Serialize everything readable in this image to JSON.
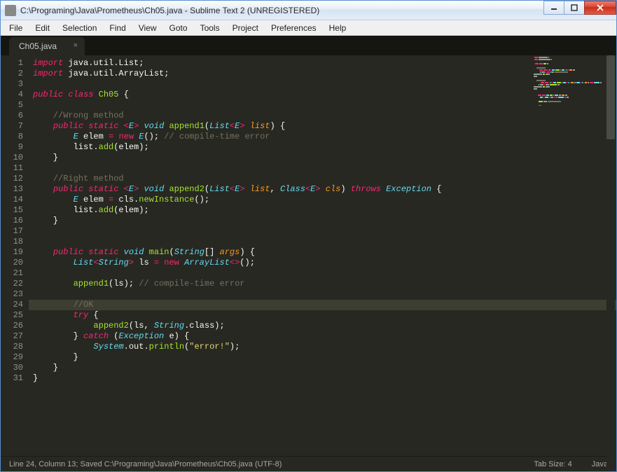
{
  "window": {
    "title": "C:\\Programing\\Java\\Prometheus\\Ch05.java - Sublime Text 2 (UNREGISTERED)"
  },
  "menu": {
    "items": [
      "File",
      "Edit",
      "Selection",
      "Find",
      "View",
      "Goto",
      "Tools",
      "Project",
      "Preferences",
      "Help"
    ]
  },
  "tab": {
    "label": "Ch05.java"
  },
  "code": {
    "line_count": 31,
    "highlighted_line": 24,
    "lines": [
      [
        [
          "kw",
          "import"
        ],
        [
          "p",
          " "
        ],
        [
          "pkg",
          "java.util.List"
        ],
        [
          "p",
          ";"
        ]
      ],
      [
        [
          "kw",
          "import"
        ],
        [
          "p",
          " "
        ],
        [
          "pkg",
          "java.util.ArrayList"
        ],
        [
          "p",
          ";"
        ]
      ],
      [],
      [
        [
          "kw",
          "public"
        ],
        [
          "p",
          " "
        ],
        [
          "kw",
          "class"
        ],
        [
          "p",
          " "
        ],
        [
          "func",
          "Ch05"
        ],
        [
          "p",
          " {"
        ]
      ],
      [],
      [
        [
          "p",
          "    "
        ],
        [
          "cmt",
          "//Wrong method"
        ]
      ],
      [
        [
          "p",
          "    "
        ],
        [
          "kw",
          "public"
        ],
        [
          "p",
          " "
        ],
        [
          "kw",
          "static"
        ],
        [
          "p",
          " "
        ],
        [
          "op",
          "<"
        ],
        [
          "type",
          "E"
        ],
        [
          "op",
          ">"
        ],
        [
          "p",
          " "
        ],
        [
          "type",
          "void"
        ],
        [
          "p",
          " "
        ],
        [
          "func",
          "append1"
        ],
        [
          "p",
          "("
        ],
        [
          "type",
          "List"
        ],
        [
          "op",
          "<"
        ],
        [
          "type",
          "E"
        ],
        [
          "op",
          ">"
        ],
        [
          "p",
          " "
        ],
        [
          "var",
          "list"
        ],
        [
          "p",
          ") {"
        ]
      ],
      [
        [
          "p",
          "        "
        ],
        [
          "type",
          "E"
        ],
        [
          "p",
          " elem "
        ],
        [
          "op",
          "="
        ],
        [
          "p",
          " "
        ],
        [
          "kw2",
          "new"
        ],
        [
          "p",
          " "
        ],
        [
          "type",
          "E"
        ],
        [
          "p",
          "(); "
        ],
        [
          "cmt",
          "// compile-time error"
        ]
      ],
      [
        [
          "p",
          "        list."
        ],
        [
          "func",
          "add"
        ],
        [
          "p",
          "(elem);"
        ]
      ],
      [
        [
          "p",
          "    }"
        ]
      ],
      [],
      [
        [
          "p",
          "    "
        ],
        [
          "cmt",
          "//Right method"
        ]
      ],
      [
        [
          "p",
          "    "
        ],
        [
          "kw",
          "public"
        ],
        [
          "p",
          " "
        ],
        [
          "kw",
          "static"
        ],
        [
          "p",
          " "
        ],
        [
          "op",
          "<"
        ],
        [
          "type",
          "E"
        ],
        [
          "op",
          ">"
        ],
        [
          "p",
          " "
        ],
        [
          "type",
          "void"
        ],
        [
          "p",
          " "
        ],
        [
          "func",
          "append2"
        ],
        [
          "p",
          "("
        ],
        [
          "type",
          "List"
        ],
        [
          "op",
          "<"
        ],
        [
          "type",
          "E"
        ],
        [
          "op",
          ">"
        ],
        [
          "p",
          " "
        ],
        [
          "var",
          "list"
        ],
        [
          "p",
          ", "
        ],
        [
          "type",
          "Class"
        ],
        [
          "op",
          "<"
        ],
        [
          "type",
          "E"
        ],
        [
          "op",
          ">"
        ],
        [
          "p",
          " "
        ],
        [
          "var",
          "cls"
        ],
        [
          "p",
          ") "
        ],
        [
          "kw",
          "throws"
        ],
        [
          "p",
          " "
        ],
        [
          "type",
          "Exception"
        ],
        [
          "p",
          " {"
        ]
      ],
      [
        [
          "p",
          "        "
        ],
        [
          "type",
          "E"
        ],
        [
          "p",
          " elem "
        ],
        [
          "op",
          "="
        ],
        [
          "p",
          " cls."
        ],
        [
          "func",
          "newInstance"
        ],
        [
          "p",
          "();"
        ]
      ],
      [
        [
          "p",
          "        list."
        ],
        [
          "func",
          "add"
        ],
        [
          "p",
          "(elem);"
        ]
      ],
      [
        [
          "p",
          "    }"
        ]
      ],
      [],
      [],
      [
        [
          "p",
          "    "
        ],
        [
          "kw",
          "public"
        ],
        [
          "p",
          " "
        ],
        [
          "kw",
          "static"
        ],
        [
          "p",
          " "
        ],
        [
          "type",
          "void"
        ],
        [
          "p",
          " "
        ],
        [
          "func",
          "main"
        ],
        [
          "p",
          "("
        ],
        [
          "type",
          "String"
        ],
        [
          "p",
          "[] "
        ],
        [
          "var",
          "args"
        ],
        [
          "p",
          ") {"
        ]
      ],
      [
        [
          "p",
          "        "
        ],
        [
          "type",
          "List"
        ],
        [
          "op",
          "<"
        ],
        [
          "type",
          "String"
        ],
        [
          "op",
          ">"
        ],
        [
          "p",
          " ls "
        ],
        [
          "op",
          "="
        ],
        [
          "p",
          " "
        ],
        [
          "kw2",
          "new"
        ],
        [
          "p",
          " "
        ],
        [
          "type",
          "ArrayList"
        ],
        [
          "op",
          "<>"
        ],
        [
          "p",
          "();"
        ]
      ],
      [],
      [
        [
          "p",
          "        "
        ],
        [
          "func",
          "append1"
        ],
        [
          "p",
          "(ls); "
        ],
        [
          "cmt",
          "// compile-time error"
        ]
      ],
      [],
      [
        [
          "p",
          "        "
        ],
        [
          "cmt",
          "//OK"
        ]
      ],
      [
        [
          "p",
          "        "
        ],
        [
          "kw",
          "try"
        ],
        [
          "p",
          " {"
        ]
      ],
      [
        [
          "p",
          "            "
        ],
        [
          "func",
          "append2"
        ],
        [
          "p",
          "(ls, "
        ],
        [
          "type",
          "String"
        ],
        [
          "p",
          ".class);"
        ]
      ],
      [
        [
          "p",
          "        } "
        ],
        [
          "kw",
          "catch"
        ],
        [
          "p",
          " ("
        ],
        [
          "type",
          "Exception"
        ],
        [
          "p",
          " e) {"
        ]
      ],
      [
        [
          "p",
          "            "
        ],
        [
          "type",
          "System"
        ],
        [
          "p",
          ".out."
        ],
        [
          "func",
          "println"
        ],
        [
          "p",
          "("
        ],
        [
          "str",
          "\"error!\""
        ],
        [
          "p",
          ");"
        ]
      ],
      [
        [
          "p",
          "        }"
        ]
      ],
      [
        [
          "p",
          "    }"
        ]
      ],
      [
        [
          "p",
          "}"
        ]
      ]
    ]
  },
  "status": {
    "left": "Line 24, Column 13; Saved C:\\Programing\\Java\\Prometheus\\Ch05.java (UTF-8)",
    "tab_size": "Tab Size: 4",
    "syntax": "Java"
  },
  "minimap_palette": {
    "kw": "#f92672",
    "type": "#66d9ef",
    "func": "#a6e22e",
    "var": "#fd971f",
    "cmt": "#75715e",
    "str": "#e6db74",
    "p": "#9c9c94"
  }
}
